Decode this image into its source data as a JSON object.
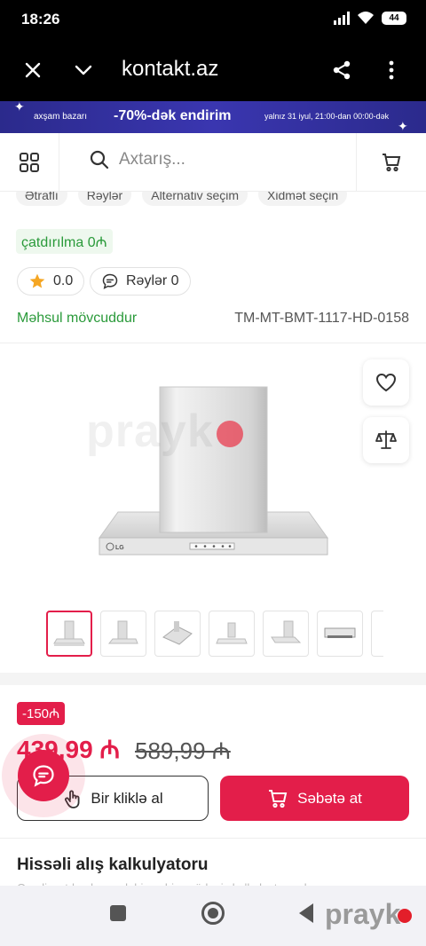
{
  "status_bar": {
    "time": "18:26",
    "battery": "44"
  },
  "browser": {
    "url": "kontakt.az"
  },
  "promo": {
    "left_text": "axşam bazarı",
    "center_text": "-70%-dək endirim",
    "right_text": "yalnız 31 iyul, 21:00-dan 00:00-dək"
  },
  "search": {
    "placeholder": "Axtarış..."
  },
  "chips": [
    "Ətraflı",
    "Rəylər",
    "Alternativ seçim",
    "Xidmət seçin"
  ],
  "delivery": {
    "label": "çatdırılma 0₼"
  },
  "rating": {
    "value": "0.0"
  },
  "reviews": {
    "label": "Rəylər 0"
  },
  "availability": {
    "label": "Məhsul mövcuddur"
  },
  "sku": "TM-MT-BMT-1117-HD-0158",
  "watermark": "prayk",
  "product": {
    "brand": "LG"
  },
  "pricing": {
    "discount": "-150₼",
    "price": "439,99 ₼",
    "old_price": "589,99 ₼"
  },
  "buttons": {
    "one_click": "Bir kliklə al",
    "add_to_cart": "Səbətə at"
  },
  "calculator": {
    "title": "Hissəli alış kalkulyatoru",
    "subtitle": "Qeydiyyatdan keçərək hissə-hissə ödəniş kalkulyatorundan"
  },
  "nav_logo": "prayk",
  "colors": {
    "accent": "#e31e4a",
    "green": "#2a9a3a",
    "promo_bg": "#2b2a8c"
  }
}
